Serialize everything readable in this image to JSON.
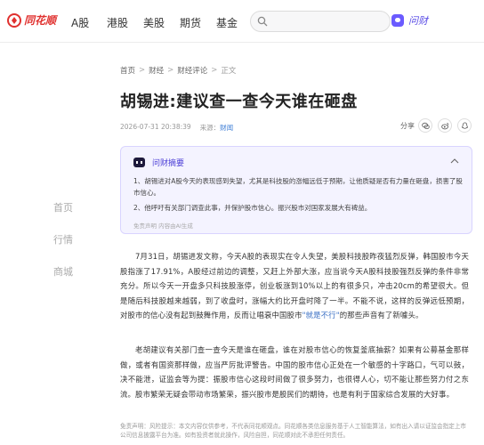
{
  "nav": {
    "logo_text": "同花顺",
    "items": [
      "A股",
      "港股",
      "美股",
      "期货",
      "基金"
    ],
    "wencai_label": "问财"
  },
  "breadcrumb": [
    "首页",
    "财经",
    "财经评论",
    "正文"
  ],
  "article": {
    "title": "胡锡进:建议查一查今天谁在砸盘",
    "time": "2026-07-31 20:38:39",
    "source_label": "来源：",
    "source_value": "财闻",
    "share_label": "分享"
  },
  "side_nav": [
    "首页",
    "行情",
    "商城"
  ],
  "ai_summary": {
    "title": "问财摘要",
    "items": [
      "1、胡锡进对A股今天的表现感到失望，尤其是科技股的涨幅远低于预期，让他质疑是否有力量在砸盘，损害了股市信心。",
      "2、他呼吁有关部门调查此事，并保护股市信心。振兴股市对国家发展大有裨益。"
    ],
    "footer": "免责声明 内容由AI生成"
  },
  "paragraphs": [
    {
      "pre": "7月31日，胡锡进发文称，今天A股的表现实在令人失望，美股科技股昨夜猛烈反弹，韩国股市今天股指涨了17.91%，A股经过前边的调整，又赶上外部大涨，应当说今天A股科技股强烈反弹的条件非常充分。所以今天一开盘多只科技股涨停，创业板涨到10%以上的有很多只，冲击20cm的希望很大。但是随后科技股越来越弱，到了收盘时，涨幅大约比开盘时降了一半。不能不说，这样的反弹远低预期，对股市的信心没有起到鼓舞作用，反而让唱衰中国股市",
      "highlight": "\"就是不行\"",
      "post": "的那些声音有了新噱头。"
    },
    {
      "pre": "老胡建议有关部门查一查今天是谁在砸盘，谁在对股市信心的恢复釜底抽薪？如果有公募基金那样做，或者有国资那样做，应当严厉批评警告。中国的股市信心正处在一个敏感的十字路口，气可以鼓，决不能泄，证监会等为提：振股市信心这段时间做了很多努力，也很得人心，切不能让那些努力付之东流。股市繁荣无疑会带动市场繁荣，振兴股市是股民们的期待，也是有利于国家综合发展的大好事。",
      "highlight": "",
      "post": ""
    }
  ],
  "disclaimer": "免责声明：风险提示：本文内容仅供参考，不代表同花顺观点。同花顺各类信息服务基于人工智能算法，如有出入请以证监会指定上市公司信息披露平台为准。如有投资者就此操作，风险自担，同花顺对此不承担任何责任。"
}
